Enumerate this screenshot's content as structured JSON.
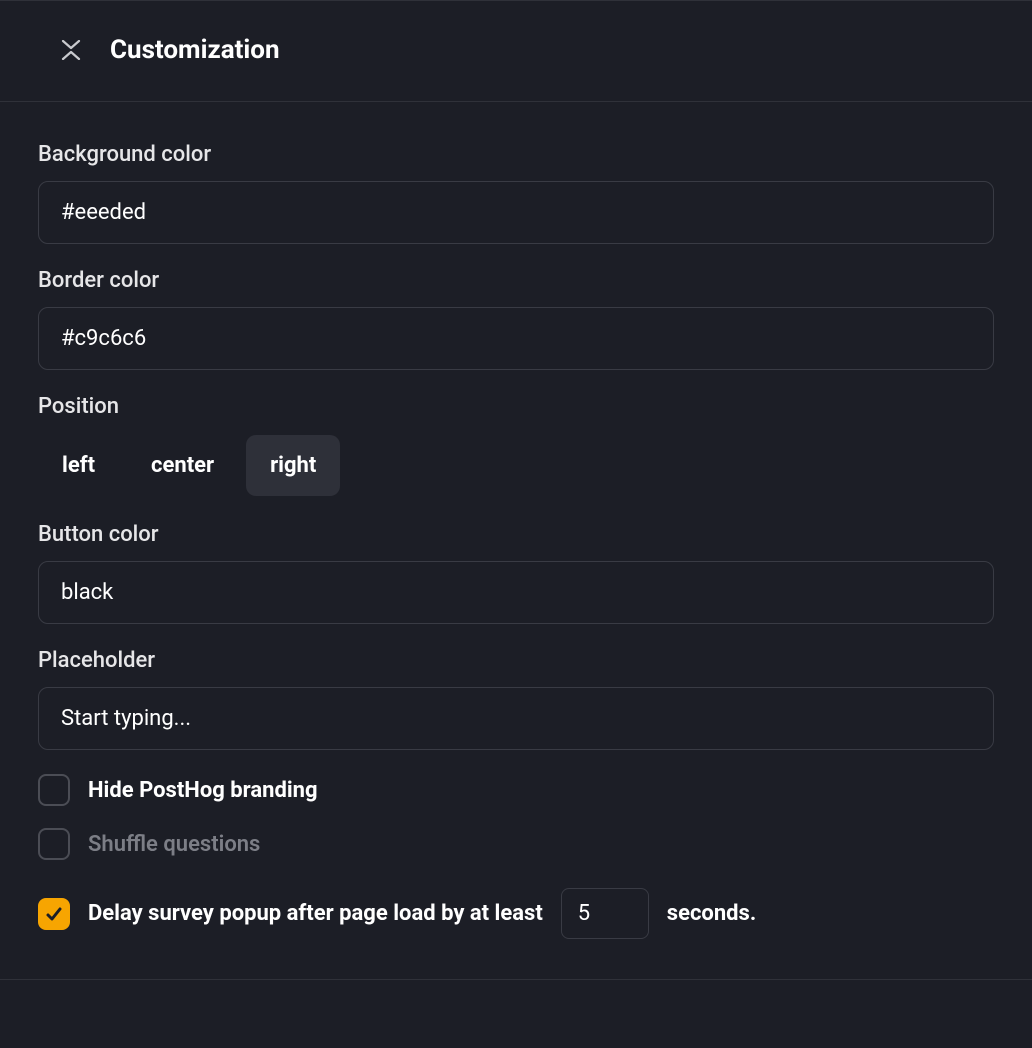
{
  "header": {
    "title": "Customization"
  },
  "fields": {
    "background_color": {
      "label": "Background color",
      "value": "#eeeded"
    },
    "border_color": {
      "label": "Border color",
      "value": "#c9c6c6"
    },
    "position": {
      "label": "Position",
      "options": [
        "left",
        "center",
        "right"
      ],
      "selected": "right"
    },
    "button_color": {
      "label": "Button color",
      "value": "black"
    },
    "placeholder": {
      "label": "Placeholder",
      "value": "Start typing..."
    }
  },
  "checkboxes": {
    "hide_branding": {
      "label": "Hide PostHog branding",
      "checked": false
    },
    "shuffle_questions": {
      "label": "Shuffle questions",
      "checked": false,
      "muted": true
    },
    "delay_popup": {
      "prefix": "Delay survey popup after page load by at least",
      "value": "5",
      "suffix": "seconds.",
      "checked": true
    }
  }
}
